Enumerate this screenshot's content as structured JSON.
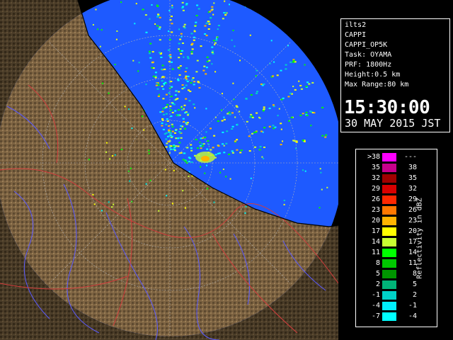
{
  "window": {
    "title": ""
  },
  "info": {
    "site": "ilts2",
    "product": "CAPPI",
    "product_name": "CAPPI_OP5K",
    "task": "Task: OYAMA",
    "prf": "PRF: 1800Hz",
    "height": "Height:0.5 km",
    "max_range": "Max Range:80 km",
    "time": "15:30:00",
    "date": "30 MAY 2015 JST"
  },
  "legend": {
    "unit": "Reflectivity in dBZ",
    "rows": [
      {
        "low": ">38",
        "high": "---",
        "color": "#ff00ff"
      },
      {
        "low": "35",
        "high": "38",
        "color": "#c8008c"
      },
      {
        "low": "32",
        "high": "35",
        "color": "#a00000"
      },
      {
        "low": "29",
        "high": "32",
        "color": "#d80000"
      },
      {
        "low": "26",
        "high": "29",
        "color": "#ff2800"
      },
      {
        "low": "23",
        "high": "26",
        "color": "#ff7800"
      },
      {
        "low": "20",
        "high": "23",
        "color": "#ffb400"
      },
      {
        "low": "17",
        "high": "20",
        "color": "#ffff00"
      },
      {
        "low": "14",
        "high": "17",
        "color": "#c8ff32"
      },
      {
        "low": "11",
        "high": "14",
        "color": "#00ff00"
      },
      {
        "low": "8",
        "high": "11",
        "color": "#00c800"
      },
      {
        "low": "5",
        "high": "8",
        "color": "#009600"
      },
      {
        "low": "2",
        "high": "5",
        "color": "#00b478"
      },
      {
        "low": "-1",
        "high": "2",
        "color": "#00d2c8"
      },
      {
        "low": "-4",
        "high": "-1",
        "color": "#00f0ff"
      },
      {
        "low": "-7",
        "high": "-4",
        "color": "#00ffff"
      }
    ]
  },
  "map": {
    "sea_color": "#1e5aff",
    "land_color": "#7a6240",
    "outside_color": "#000000"
  }
}
